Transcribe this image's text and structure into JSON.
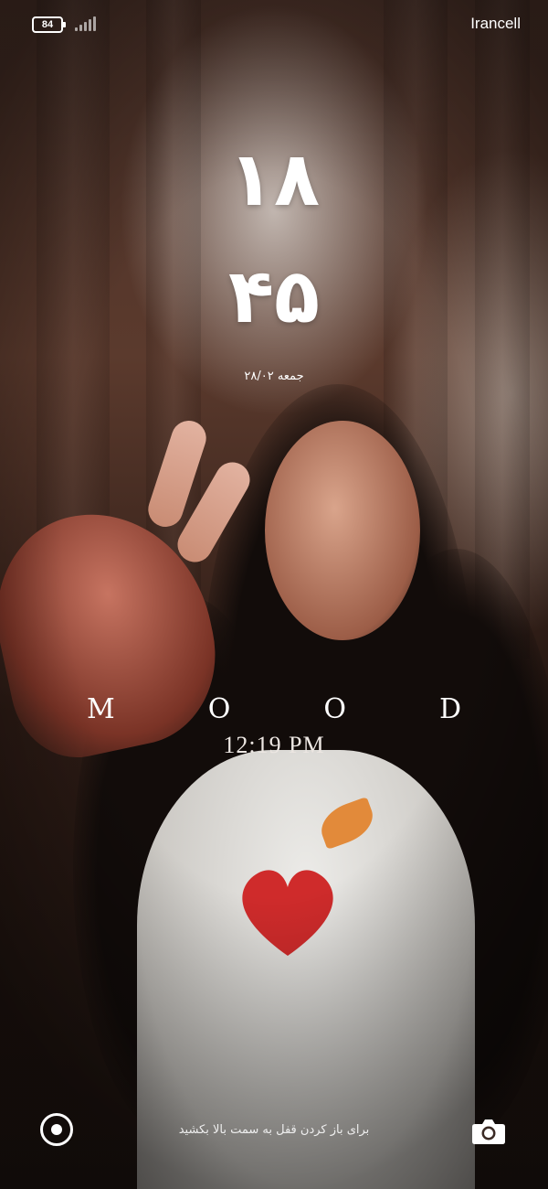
{
  "status_bar": {
    "battery": "84",
    "carrier": "Irancell"
  },
  "clock": {
    "hour": "۱۸",
    "minute": "۴۵",
    "date": "جمعه ۲۸/۰۲"
  },
  "widget": {
    "title_letters": [
      "M",
      "O",
      "O",
      "D"
    ],
    "time": "12:19 PM"
  },
  "bottom": {
    "unlock_hint": "برای باز کردن قفل به سمت بالا بکشید",
    "left_icon": "shortcut-circle-icon",
    "right_icon": "camera-icon"
  }
}
